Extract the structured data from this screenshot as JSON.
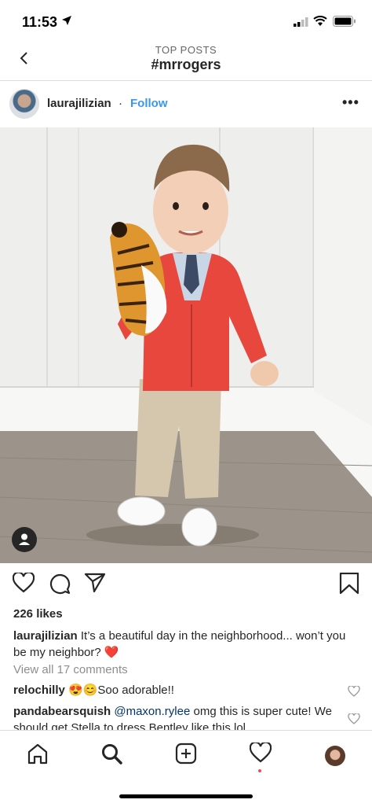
{
  "status": {
    "time": "11:53"
  },
  "nav": {
    "subtitle": "TOP POSTS",
    "title": "#mrrogers"
  },
  "post": {
    "username": "laurajilizian",
    "separator": "·",
    "follow_label": "Follow",
    "more_label": "•••",
    "likes": "226 likes",
    "caption_user": "laurajilizian",
    "caption_text": " It’s a beautiful day in the neighborhood... won’t you be my neighbor? ❤️",
    "view_all": "View all 17 comments"
  },
  "comments": [
    {
      "user": "relochilly",
      "text": " 😍😊Soo adorable!!"
    },
    {
      "user": "pandabearsquish",
      "mention": " @maxon.rylee",
      "text": " omg this is super cute! We should get Stella to dress Bentley like this lol"
    }
  ],
  "icons": {
    "back": "chevron-left-icon",
    "like": "heart-icon",
    "comment": "comment-icon",
    "share": "paper-plane-icon",
    "save": "bookmark-icon",
    "tags": "person-tag-icon",
    "home": "home-icon",
    "search": "search-icon",
    "new_post": "add-post-icon",
    "activity": "heart-icon",
    "profile": "profile-avatar"
  },
  "colors": {
    "link": "#3897f0",
    "sweater": "#e8473e",
    "notification_dot": "#ed4956"
  }
}
